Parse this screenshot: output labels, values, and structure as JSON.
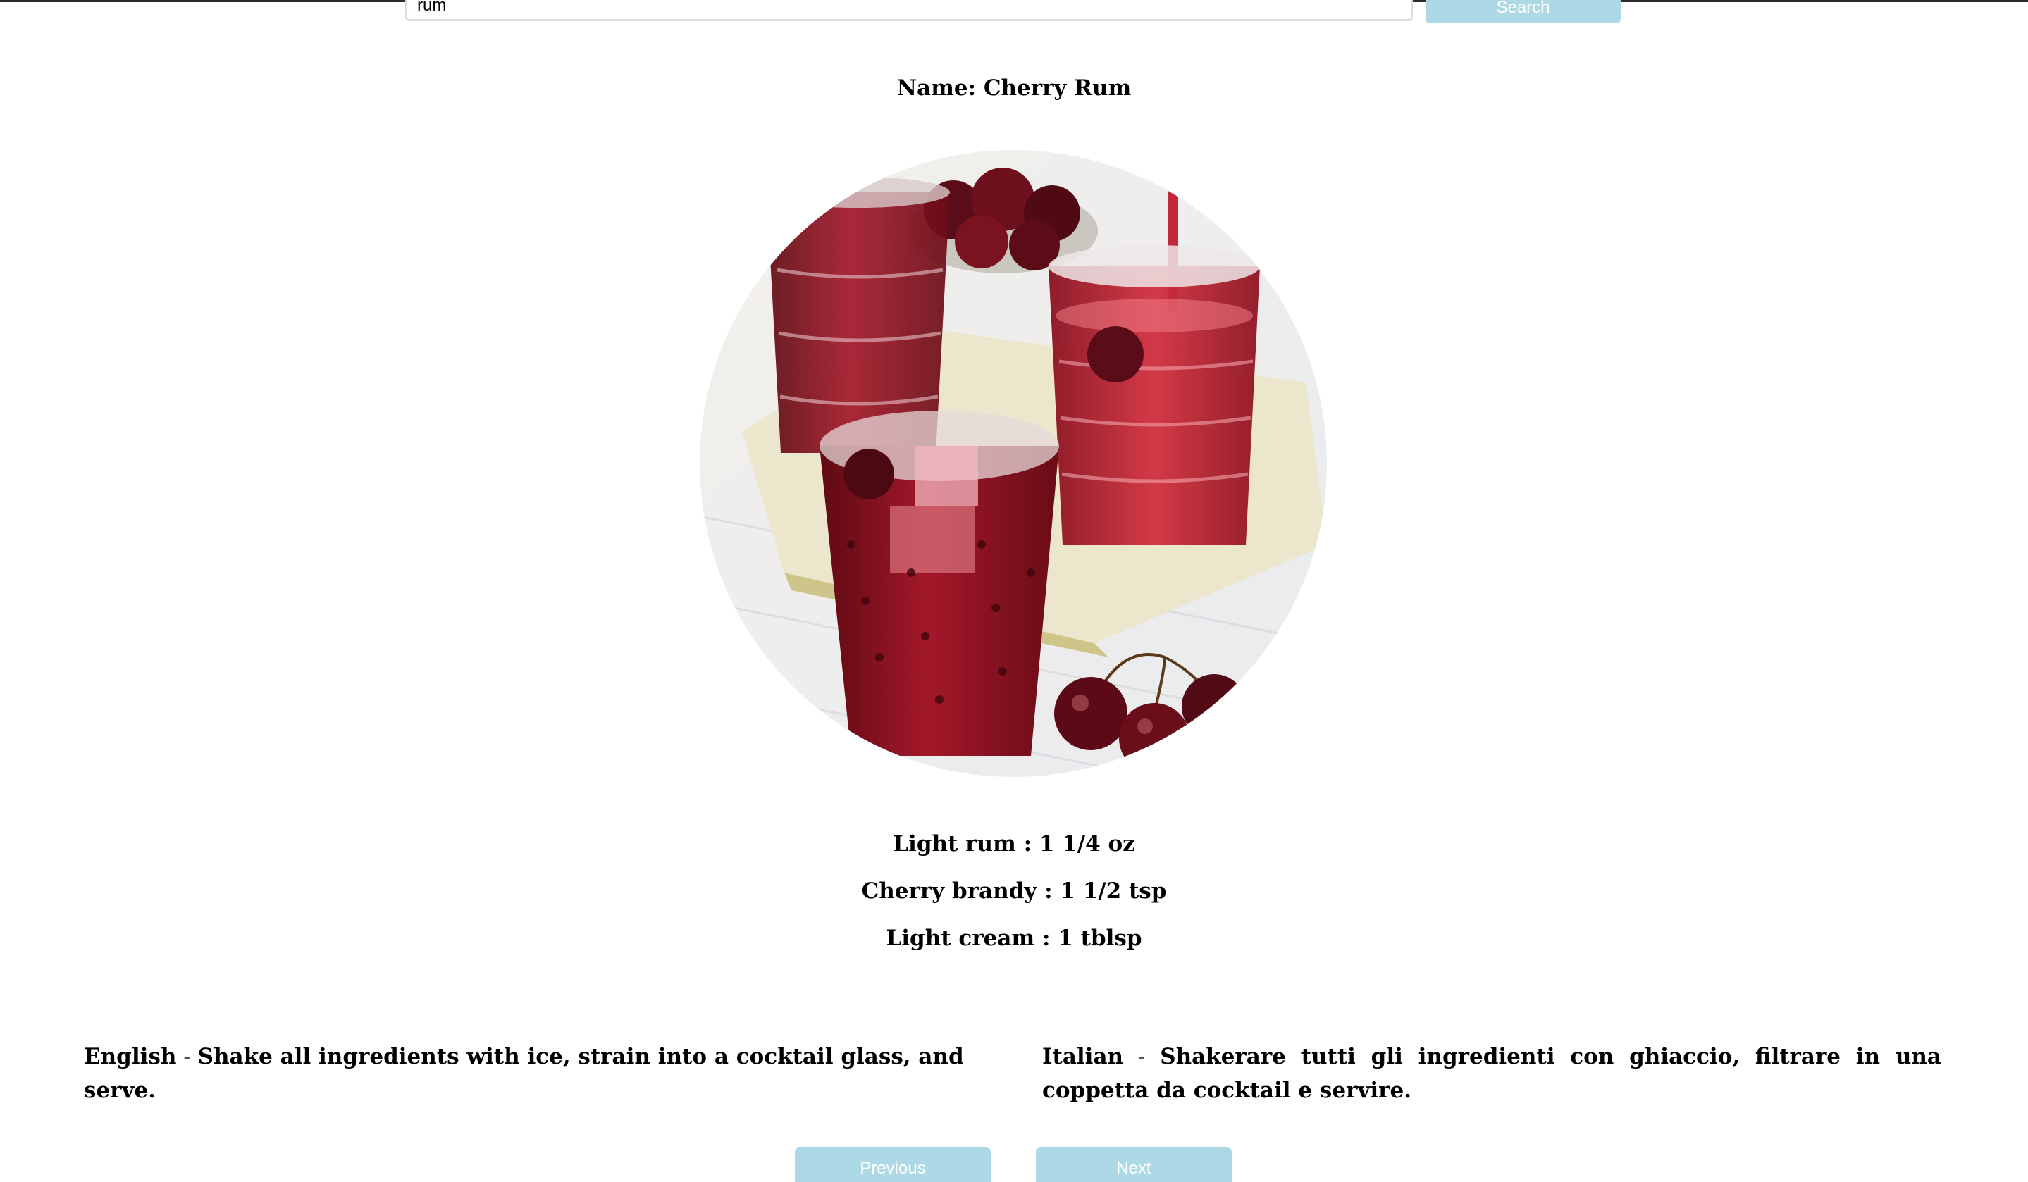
{
  "search": {
    "value": "rum",
    "button_label": "Search"
  },
  "drink": {
    "name_label": "Name: Cherry Rum",
    "image_icon": "cherry-rum-photo",
    "ingredients": [
      "Light rum : 1 1/4 oz",
      "Cherry brandy : 1 1/2 tsp",
      "Light cream : 1 tblsp"
    ],
    "instructions": {
      "english_label": "English",
      "english_text": "Shake all ingredients with ice, strain into a cocktail glass, and serve.",
      "italian_label": "Italian",
      "italian_text": "Shakerare tutti gli ingredienti con ghiaccio, filtrare in una coppetta da cocktail e servire.",
      "separator": " - "
    }
  },
  "pagination": {
    "previous_label": "Previous",
    "next_label": "Next"
  },
  "colors": {
    "button_bg": "#add8e6",
    "button_text": "#ffffff",
    "drink_red": "#9b1424"
  }
}
